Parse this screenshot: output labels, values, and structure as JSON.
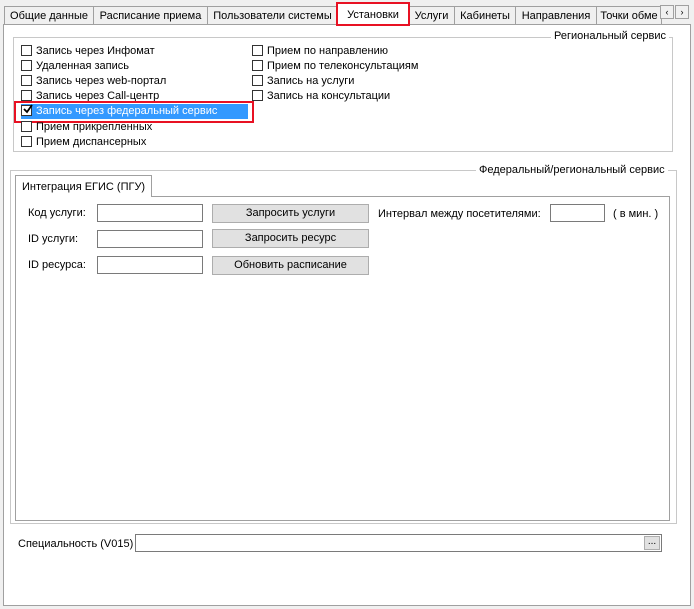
{
  "tabs": [
    {
      "label": "Общие данные"
    },
    {
      "label": "Расписание приема"
    },
    {
      "label": "Пользователи системы"
    },
    {
      "label": "Установки"
    },
    {
      "label": "Услуги"
    },
    {
      "label": "Кабинеты"
    },
    {
      "label": "Направления"
    },
    {
      "label": "Точки обме"
    }
  ],
  "scroll": {
    "left": "‹",
    "right": "›"
  },
  "regional": {
    "legend": "Региональный сервис",
    "col1": [
      {
        "label": "Запись через Инфомат",
        "checked": false
      },
      {
        "label": "Удаленная запись",
        "checked": false
      },
      {
        "label": "Запись через web-портал",
        "checked": false
      },
      {
        "label": "Запись через Call-центр",
        "checked": false
      },
      {
        "label": "Запись через федеральный сервис",
        "checked": true
      },
      {
        "label": "Прием прикрепленных",
        "checked": false
      },
      {
        "label": "Прием диспансерных",
        "checked": false
      }
    ],
    "col2": [
      {
        "label": "Прием по направлению",
        "checked": false
      },
      {
        "label": "Прием по телеконсультациям",
        "checked": false
      },
      {
        "label": "Запись на услуги",
        "checked": false
      },
      {
        "label": "Запись на консультации",
        "checked": false
      }
    ]
  },
  "federal": {
    "legend": "Федеральный/региональный сервис",
    "tab": "Интеграция ЕГИС (ПГУ)",
    "service_code_label": "Код услуги:",
    "service_id_label": "ID услуги:",
    "resource_id_label": "ID ресурса:",
    "service_code_value": "",
    "service_id_value": "",
    "resource_id_value": "",
    "btn_request_services": "Запросить услуги",
    "btn_request_resource": "Запросить ресурс",
    "btn_update_schedule": "Обновить расписание",
    "interval_label": "Интервал между посетителями:",
    "interval_value": "",
    "interval_unit": "( в мин. )"
  },
  "specialty": {
    "label": "Специальность (V015)",
    "value": "",
    "btn": "..."
  }
}
